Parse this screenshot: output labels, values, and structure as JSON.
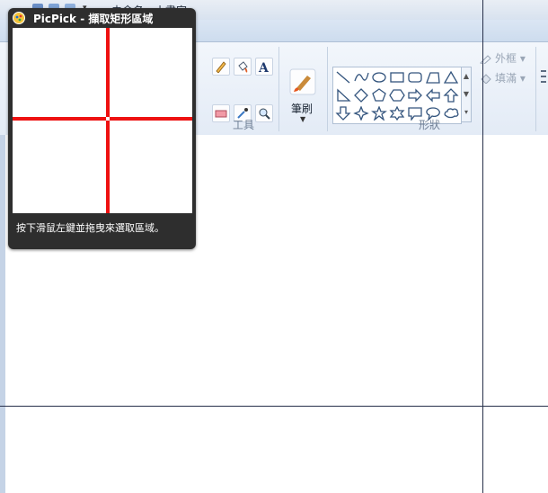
{
  "window": {
    "title": "未命名 - 小畫家"
  },
  "ribbon": {
    "groups": {
      "tools_label": "工具",
      "shapes_label": "形狀"
    },
    "brush": {
      "label": "筆刷"
    },
    "shape_options": {
      "outline_label": "外框",
      "fill_label": "填滿"
    }
  },
  "picpick": {
    "title": "PicPick - 擷取矩形區域",
    "hint": "按下滑鼠左鍵並拖曳來選取區域。"
  },
  "colors": {
    "popup_bg": "#2e2e2e",
    "crosshair_red": "#ee1111",
    "crosshair_line": "#27304a",
    "ribbon_bg": "#e3ebf6"
  }
}
